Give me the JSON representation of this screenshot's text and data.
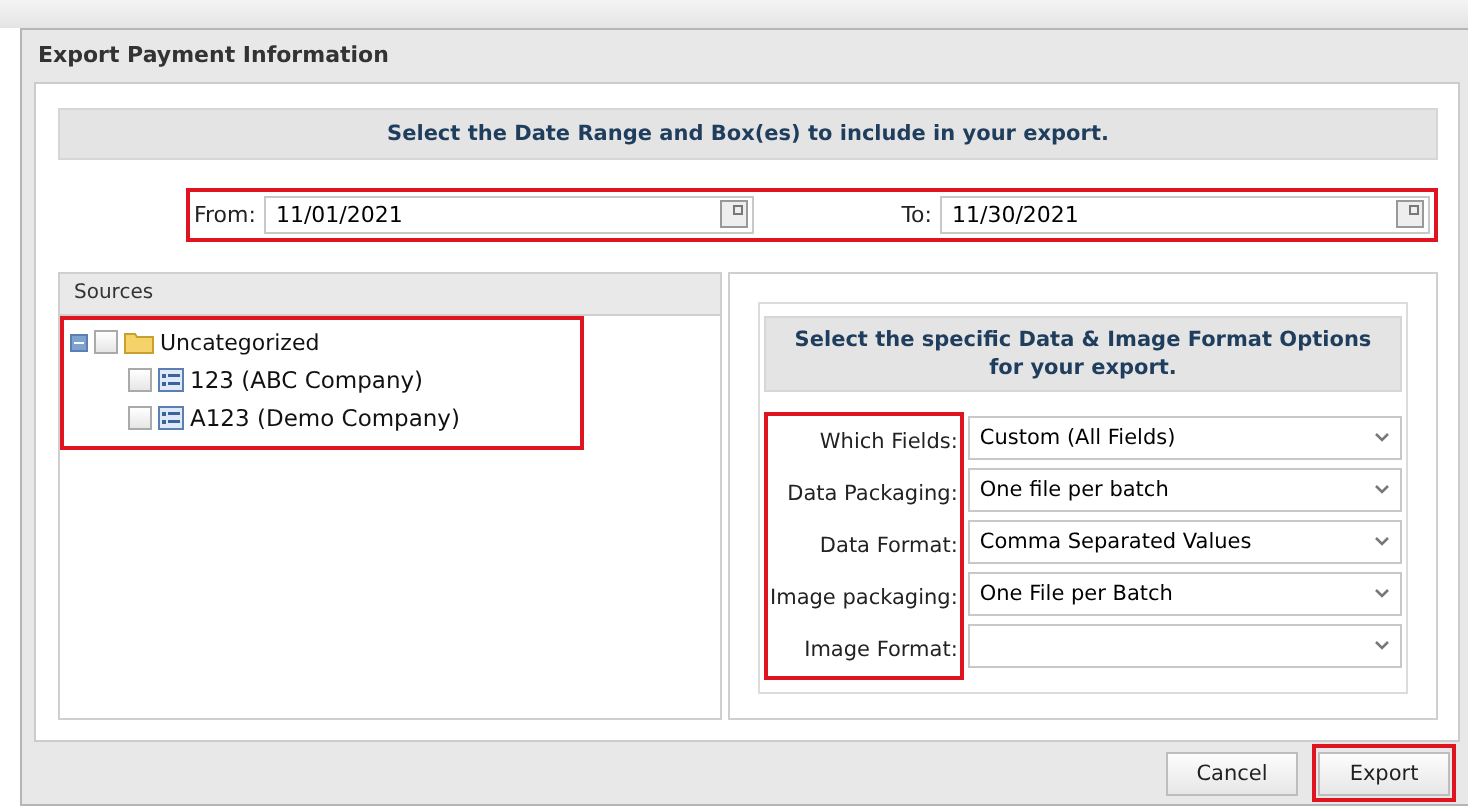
{
  "window": {
    "title": "Export Payment Information"
  },
  "date_section": {
    "heading": "Select the Date Range and Box(es) to include in your export.",
    "highlighted": true,
    "from": {
      "label": "From:",
      "value": "11/01/2021"
    },
    "to": {
      "label": "To:",
      "value": "11/30/2021"
    }
  },
  "sources": {
    "title": "Sources",
    "highlighted": true,
    "tree": [
      {
        "label": "Uncategorized",
        "kind": "folder",
        "expanded": true,
        "checked": false,
        "children": [
          {
            "label": "123 (ABC Company)",
            "kind": "box",
            "checked": false
          },
          {
            "label": "A123 (Demo Company)",
            "kind": "box",
            "checked": false
          }
        ]
      }
    ]
  },
  "options": {
    "heading": "Select the specific Data & Image Format Options for your export.",
    "labels_highlighted": true,
    "fields": [
      {
        "label": "Which Fields:",
        "value": "Custom (All Fields)"
      },
      {
        "label": "Data Packaging:",
        "value": "One file per batch"
      },
      {
        "label": "Data Format:",
        "value": "Comma Separated Values"
      },
      {
        "label": "Image packaging:",
        "value": "One File per Batch"
      },
      {
        "label": "Image Format:"
      }
    ]
  },
  "buttons": [
    {
      "label": "Cancel",
      "highlighted": false
    },
    {
      "label": "Export",
      "highlighted": true
    }
  ]
}
